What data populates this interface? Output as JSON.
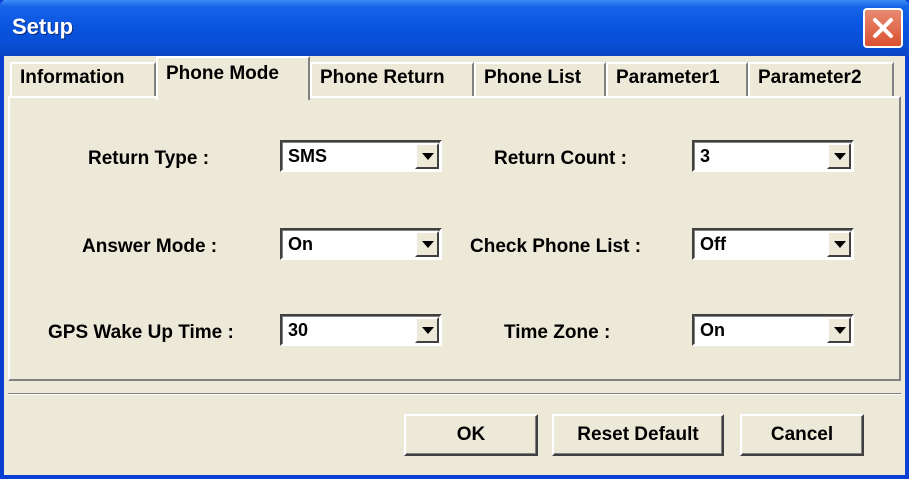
{
  "window": {
    "title": "Setup"
  },
  "tabs": [
    {
      "label": "Information"
    },
    {
      "label": "Phone Mode"
    },
    {
      "label": "Phone Return"
    },
    {
      "label": "Phone List"
    },
    {
      "label": "Parameter1"
    },
    {
      "label": "Parameter2"
    }
  ],
  "active_tab": "Phone Mode",
  "fields": {
    "return_type": {
      "label": "Return Type :",
      "value": "SMS"
    },
    "return_count": {
      "label": "Return Count :",
      "value": "3"
    },
    "answer_mode": {
      "label": "Answer Mode :",
      "value": "On"
    },
    "check_phone_list": {
      "label": "Check Phone List :",
      "value": "Off"
    },
    "gps_wake_up_time": {
      "label": "GPS Wake Up Time :",
      "value": "30"
    },
    "time_zone": {
      "label": "Time Zone :",
      "value": "On"
    }
  },
  "buttons": {
    "ok": "OK",
    "reset_default": "Reset Default",
    "cancel": "Cancel"
  },
  "colors": {
    "titlebar": "#0a55e0",
    "window_bg": "#ece9d8",
    "close_button": "#d9512f"
  },
  "icons": {
    "close": "close-x-icon",
    "dropdown": "chevron-down-icon"
  }
}
